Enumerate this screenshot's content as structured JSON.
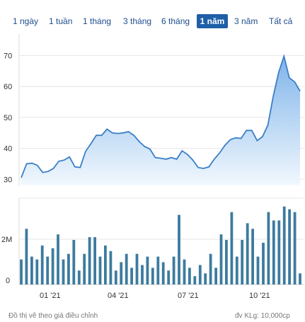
{
  "range_tabs": [
    "1 ngày",
    "1 tuần",
    "1 tháng",
    "3 tháng",
    "6 tháng",
    "1 năm",
    "3 năm",
    "Tất cả"
  ],
  "active_tab": "1 năm",
  "colors": {
    "line": "#3a7fc6",
    "fill_top": "#7fb4ea",
    "fill_bottom": "#f2f8fe",
    "volume": "#3d7b9e",
    "active_tab": "#1f5fa8",
    "tab_text": "#1f4d8c"
  },
  "footer": {
    "left": "Đồ thị vẽ theo giá điều chỉnh",
    "right": "đv KLg: 10,000cp"
  },
  "chart_data": [
    {
      "type": "area",
      "x_start": "2020-11-20",
      "x_tick_labels": [
        "01 '21",
        "04 '21",
        "07 '21",
        "10 '21"
      ],
      "yticks": [
        30,
        40,
        50,
        60,
        70
      ],
      "ylim": [
        28,
        77
      ],
      "grid": true,
      "values": [
        30.5,
        35,
        35.2,
        34.5,
        32.2,
        32.5,
        33.5,
        35.8,
        36.2,
        37.2,
        34,
        33.8,
        39,
        41.5,
        44.2,
        44.2,
        46.2,
        45,
        44.8,
        45,
        45.4,
        44.2,
        42.2,
        40.6,
        39.8,
        37,
        36.8,
        36.5,
        37,
        36.5,
        39.2,
        38,
        36.2,
        33.8,
        33.5,
        34,
        36.5,
        38.5,
        41,
        42.8,
        43.4,
        43.2,
        45.8,
        45.8,
        42.5,
        43.8,
        47.5,
        56.8,
        64.5,
        69.8,
        62.8,
        61.5,
        58.5
      ]
    },
    {
      "type": "bar",
      "ylabel_ticks": [
        "2M",
        "0"
      ],
      "ylim": [
        0,
        3.1
      ],
      "values": [
        0.9,
        2.0,
        1.0,
        0.9,
        1.4,
        1.0,
        1.3,
        1.8,
        0.9,
        1.1,
        1.6,
        0.5,
        1.1,
        1.7,
        1.7,
        1.0,
        1.4,
        1.2,
        0.5,
        0.8,
        1.1,
        0.6,
        1.1,
        0.7,
        1.0,
        0.6,
        1.0,
        0.8,
        0.5,
        1.0,
        2.5,
        0.9,
        0.6,
        0.3,
        0.7,
        0.4,
        1.1,
        0.6,
        1.8,
        1.6,
        2.6,
        1.0,
        1.6,
        2.2,
        2.0,
        1.0,
        1.5,
        2.6,
        2.3,
        2.3,
        2.8,
        2.7,
        2.6,
        0.4
      ]
    }
  ]
}
